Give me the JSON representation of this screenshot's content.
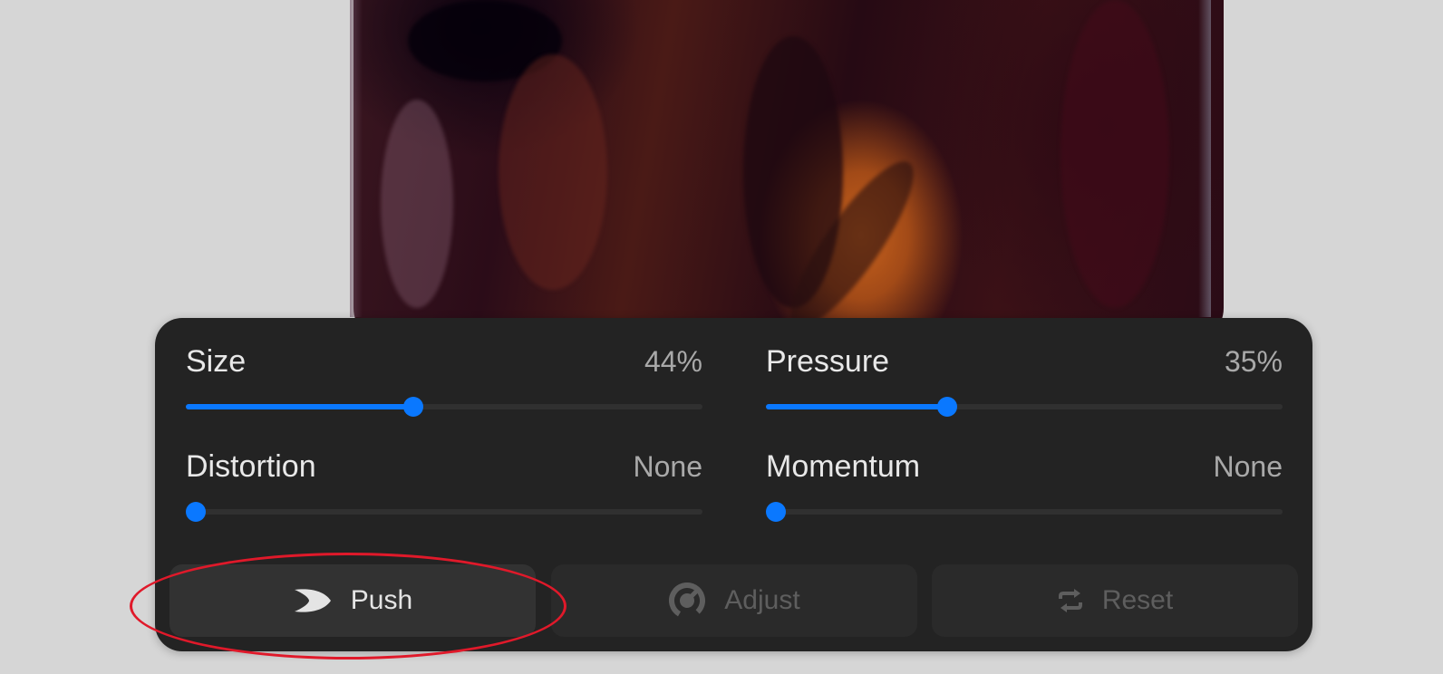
{
  "controls": {
    "size": {
      "label": "Size",
      "value_text": "44%",
      "level": 0.44
    },
    "pressure": {
      "label": "Pressure",
      "value_text": "35%",
      "level": 0.35
    },
    "distortion": {
      "label": "Distortion",
      "value_text": "None",
      "level": 0.0
    },
    "momentum": {
      "label": "Momentum",
      "value_text": "None",
      "level": 0.0
    }
  },
  "buttons": {
    "push": {
      "label": "Push",
      "icon": "push-crescent-icon",
      "active": true
    },
    "adjust": {
      "label": "Adjust",
      "icon": "dial-icon",
      "active": false
    },
    "reset": {
      "label": "Reset",
      "icon": "reset-arrows-icon",
      "active": false
    }
  },
  "colors": {
    "accent": "#0a78ff",
    "panel": "#232323",
    "annotation": "#e0192a"
  }
}
